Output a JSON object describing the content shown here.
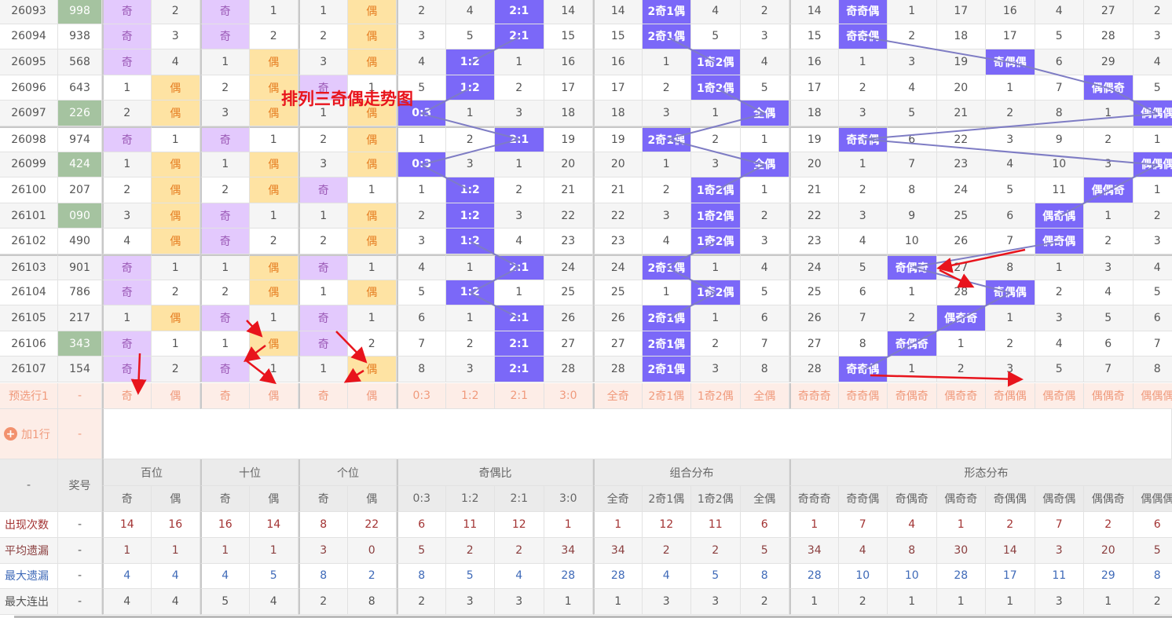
{
  "annotation_title": "排列三奇偶走势图",
  "colors": {
    "odd_hit": "#e3c9fd",
    "even_hit": "#fee3a3",
    "pattern_hit": "#7b68f8",
    "prize_highlight": "#a5c3a0",
    "preselect": "#fdede7"
  },
  "rows": [
    {
      "issue": "26093",
      "prize": "998",
      "green": true,
      "cells": [
        "奇",
        "2",
        "奇",
        "1",
        "1",
        "偶",
        "2",
        "4",
        "2:1",
        "14",
        "14",
        "2奇1偶",
        "4",
        "2",
        "14",
        "奇奇偶",
        "1",
        "17",
        "16",
        "4",
        "27",
        "2"
      ]
    },
    {
      "issue": "26094",
      "prize": "938",
      "green": false,
      "cells": [
        "奇",
        "3",
        "奇",
        "2",
        "2",
        "偶",
        "3",
        "5",
        "2:1",
        "15",
        "15",
        "2奇1偶",
        "5",
        "3",
        "15",
        "奇奇偶",
        "2",
        "18",
        "17",
        "5",
        "28",
        "3"
      ]
    },
    {
      "issue": "26095",
      "prize": "568",
      "green": false,
      "cells": [
        "奇",
        "4",
        "1",
        "偶",
        "3",
        "偶",
        "4",
        "1:2",
        "1",
        "16",
        "16",
        "1",
        "1奇2偶",
        "4",
        "16",
        "1",
        "3",
        "19",
        "奇偶偶",
        "6",
        "29",
        "4"
      ]
    },
    {
      "issue": "26096",
      "prize": "643",
      "green": false,
      "cells": [
        "1",
        "偶",
        "2",
        "偶",
        "奇",
        "1",
        "5",
        "1:2",
        "2",
        "17",
        "17",
        "2",
        "1奇2偶",
        "5",
        "17",
        "2",
        "4",
        "20",
        "1",
        "7",
        "偶偶奇",
        "5"
      ]
    },
    {
      "issue": "26097",
      "prize": "226",
      "green": true,
      "cells": [
        "2",
        "偶",
        "3",
        "偶",
        "1",
        "偶",
        "0:3",
        "1",
        "3",
        "18",
        "18",
        "3",
        "1",
        "全偶",
        "18",
        "3",
        "5",
        "21",
        "2",
        "8",
        "1",
        "偶偶偶"
      ]
    },
    {
      "issue": "26098",
      "prize": "974",
      "green": false,
      "cells": [
        "奇",
        "1",
        "奇",
        "1",
        "2",
        "偶",
        "1",
        "2",
        "2:1",
        "19",
        "19",
        "2奇1偶",
        "2",
        "1",
        "19",
        "奇奇偶",
        "6",
        "22",
        "3",
        "9",
        "2",
        "1"
      ]
    },
    {
      "issue": "26099",
      "prize": "424",
      "green": true,
      "cells": [
        "1",
        "偶",
        "1",
        "偶",
        "3",
        "偶",
        "0:3",
        "3",
        "1",
        "20",
        "20",
        "1",
        "3",
        "全偶",
        "20",
        "1",
        "7",
        "23",
        "4",
        "10",
        "3",
        "偶偶偶"
      ]
    },
    {
      "issue": "26100",
      "prize": "207",
      "green": false,
      "cells": [
        "2",
        "偶",
        "2",
        "偶",
        "奇",
        "1",
        "1",
        "1:2",
        "2",
        "21",
        "21",
        "2",
        "1奇2偶",
        "1",
        "21",
        "2",
        "8",
        "24",
        "5",
        "11",
        "偶偶奇",
        "1"
      ]
    },
    {
      "issue": "26101",
      "prize": "090",
      "green": true,
      "cells": [
        "3",
        "偶",
        "奇",
        "1",
        "1",
        "偶",
        "2",
        "1:2",
        "3",
        "22",
        "22",
        "3",
        "1奇2偶",
        "2",
        "22",
        "3",
        "9",
        "25",
        "6",
        "偶奇偶",
        "1",
        "2"
      ]
    },
    {
      "issue": "26102",
      "prize": "490",
      "green": false,
      "cells": [
        "4",
        "偶",
        "奇",
        "2",
        "2",
        "偶",
        "3",
        "1:2",
        "4",
        "23",
        "23",
        "4",
        "1奇2偶",
        "3",
        "23",
        "4",
        "10",
        "26",
        "7",
        "偶奇偶",
        "2",
        "3"
      ]
    },
    {
      "issue": "26103",
      "prize": "901",
      "green": false,
      "cells": [
        "奇",
        "1",
        "1",
        "偶",
        "奇",
        "1",
        "4",
        "1",
        "2:1",
        "24",
        "24",
        "2奇1偶",
        "1",
        "4",
        "24",
        "5",
        "奇偶奇",
        "27",
        "8",
        "1",
        "3",
        "4"
      ]
    },
    {
      "issue": "26104",
      "prize": "786",
      "green": false,
      "cells": [
        "奇",
        "2",
        "2",
        "偶",
        "1",
        "偶",
        "5",
        "1:2",
        "1",
        "25",
        "25",
        "1",
        "1奇2偶",
        "5",
        "25",
        "6",
        "1",
        "28",
        "奇偶偶",
        "2",
        "4",
        "5"
      ]
    },
    {
      "issue": "26105",
      "prize": "217",
      "green": false,
      "cells": [
        "1",
        "偶",
        "奇",
        "1",
        "奇",
        "1",
        "6",
        "1",
        "2:1",
        "26",
        "26",
        "2奇1偶",
        "1",
        "6",
        "26",
        "7",
        "2",
        "偶奇奇",
        "1",
        "3",
        "5",
        "6"
      ]
    },
    {
      "issue": "26106",
      "prize": "343",
      "green": true,
      "cells": [
        "奇",
        "1",
        "1",
        "偶",
        "奇",
        "2",
        "7",
        "2",
        "2:1",
        "27",
        "27",
        "2奇1偶",
        "2",
        "7",
        "27",
        "8",
        "奇偶奇",
        "1",
        "2",
        "4",
        "6",
        "7"
      ]
    },
    {
      "issue": "26107",
      "prize": "154",
      "green": false,
      "cells": [
        "奇",
        "2",
        "奇",
        "1",
        "1",
        "偶",
        "8",
        "3",
        "2:1",
        "28",
        "28",
        "2奇1偶",
        "3",
        "8",
        "28",
        "奇奇偶",
        "1",
        "2",
        "3",
        "5",
        "7",
        "8"
      ]
    }
  ],
  "preselect": {
    "label": "预选行1",
    "prize": "-",
    "cells": [
      "奇",
      "偶",
      "奇",
      "偶",
      "奇",
      "偶",
      "0:3",
      "1:2",
      "2:1",
      "3:0",
      "全奇",
      "2奇1偶",
      "1奇2偶",
      "全偶",
      "奇奇奇",
      "奇奇偶",
      "奇偶奇",
      "偶奇奇",
      "奇偶偶",
      "偶奇偶",
      "偶偶奇",
      "偶偶偶"
    ]
  },
  "add_row": {
    "label": "加1行",
    "prize": "-"
  },
  "header": {
    "corner": "-",
    "prize": "奖号",
    "groups": [
      {
        "label": "百位",
        "span": 2
      },
      {
        "label": "十位",
        "span": 2
      },
      {
        "label": "个位",
        "span": 2
      },
      {
        "label": "奇偶比",
        "span": 4
      },
      {
        "label": "组合分布",
        "span": 4
      },
      {
        "label": "形态分布",
        "span": 8
      }
    ],
    "sub": [
      "奇",
      "偶",
      "奇",
      "偶",
      "奇",
      "偶",
      "0:3",
      "1:2",
      "2:1",
      "3:0",
      "全奇",
      "2奇1偶",
      "1奇2偶",
      "全偶",
      "奇奇奇",
      "奇奇偶",
      "奇偶奇",
      "偶奇奇",
      "奇偶偶",
      "偶奇偶",
      "偶偶奇",
      "偶偶偶"
    ]
  },
  "stats": [
    {
      "label": "出现次数",
      "prize": "-",
      "values": [
        "14",
        "16",
        "16",
        "14",
        "8",
        "22",
        "6",
        "11",
        "12",
        "1",
        "1",
        "12",
        "11",
        "6",
        "1",
        "7",
        "4",
        "1",
        "2",
        "7",
        "2",
        "6"
      ]
    },
    {
      "label": "平均遗漏",
      "prize": "-",
      "values": [
        "1",
        "1",
        "1",
        "1",
        "3",
        "0",
        "5",
        "2",
        "2",
        "34",
        "34",
        "2",
        "2",
        "5",
        "34",
        "4",
        "8",
        "30",
        "14",
        "3",
        "20",
        "5"
      ]
    },
    {
      "label": "最大遗漏",
      "prize": "-",
      "values": [
        "4",
        "4",
        "4",
        "5",
        "8",
        "2",
        "8",
        "5",
        "4",
        "28",
        "28",
        "4",
        "5",
        "8",
        "28",
        "10",
        "10",
        "28",
        "17",
        "11",
        "29",
        "8"
      ]
    },
    {
      "label": "最大连出",
      "prize": "-",
      "values": [
        "4",
        "4",
        "5",
        "4",
        "2",
        "8",
        "2",
        "3",
        "3",
        "1",
        "1",
        "3",
        "3",
        "2",
        "1",
        "2",
        "1",
        "1",
        "1",
        "3",
        "1",
        "2"
      ]
    }
  ]
}
